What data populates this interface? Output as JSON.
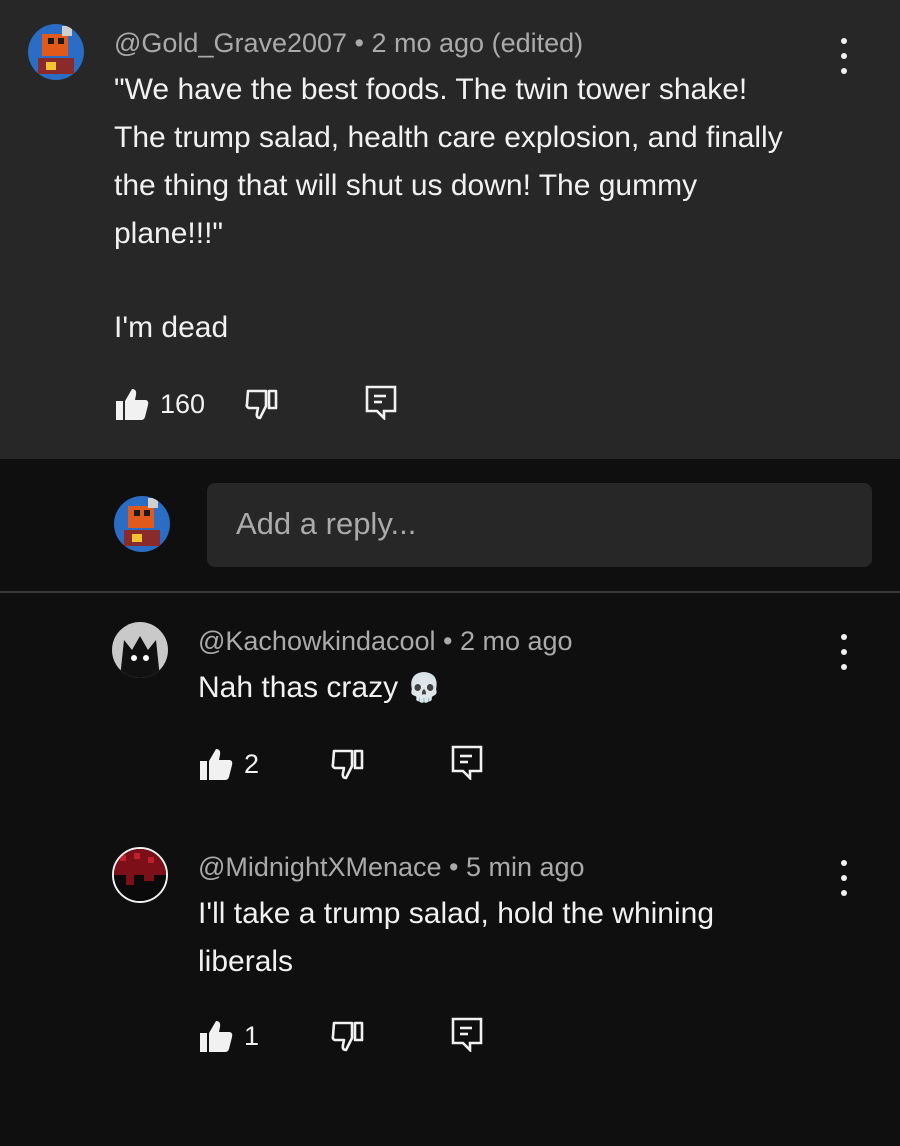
{
  "top_comment": {
    "author": "@Gold_Grave2007",
    "meta": " • 2 mo ago (edited)",
    "lines": [
      "\"We have the best foods. The twin tower shake!",
      "The trump salad, health care explosion, and finally",
      "the thing that will shut us down! The gummy",
      "plane!!!\""
    ],
    "line2": "I'm dead",
    "like_count": "160"
  },
  "reply_input": {
    "placeholder": "Add a reply..."
  },
  "replies": [
    {
      "author": "@Kachowkindacool",
      "meta": " • 2 mo ago",
      "text": "Nah thas crazy",
      "emoji": "💀",
      "like_count": "2"
    },
    {
      "author": "@MidnightXMenace",
      "meta": " • 5 min ago",
      "lines": [
        "I'll take a trump salad, hold the whining",
        "liberals"
      ],
      "like_count": "1"
    }
  ],
  "icons": {
    "like": "thumbs-up-icon",
    "dislike": "thumbs-down-icon",
    "reply": "reply-comment-icon",
    "more": "more-vert-icon"
  },
  "colors": {
    "background": "#0f0f0f",
    "highlight": "#272727",
    "secondary_text": "#aaaaaa",
    "primary_text": "#f1f1f1"
  }
}
